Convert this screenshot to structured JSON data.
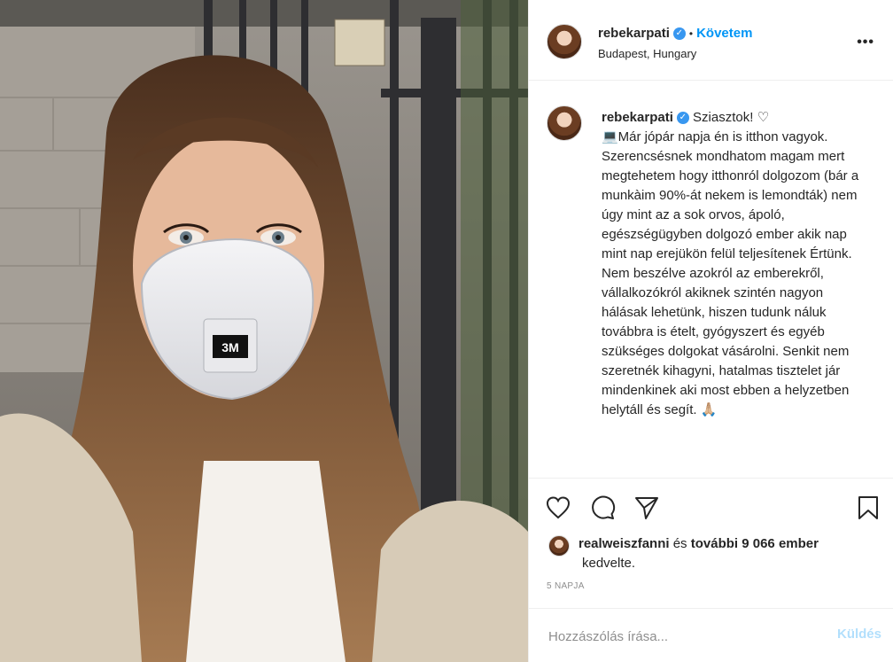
{
  "post": {
    "username": "rebekarpati",
    "verified": true,
    "follow_label": "Követem",
    "location": "Budapest, Hungary",
    "more_label": "•••",
    "caption": "Sziasztok! ♡\n💻Már jópár napja én is itthon vagyok. Szerencsésnek mondhatom magam mert megtehetem hogy itthonról dolgozom (bár a munkàim 90%-át nekem is lemondták) nem úgy mint az a sok orvos, ápoló, egészségügyben dolgozó ember akik nap mint nap erejükön felül teljesítenek Értünk. Nem beszélve azokról az emberekről, vállalkozókról akiknek szintén nagyon hálásak lehetünk, hiszen tudunk náluk továbbra is ételt, gyógyszert és egyéb szükséges dolgokat vásárolni. Senkit nem szeretnék kihagyni, hatalmas tisztelet jár mindenkinek aki most ebben a helyzetben helytáll és segít. 🙏🏼",
    "likes": {
      "liker": "realweiszfanni",
      "connector": " és ",
      "others": "további 9 066 ember",
      "suffix": "kedvelte."
    },
    "timestamp": "5 NAPJA",
    "comment": {
      "placeholder": "Hozzászólás írása...",
      "value": "",
      "post_label": "Küldés"
    }
  },
  "icons": {
    "verified": "verified-badge-icon",
    "like": "heart-icon",
    "comment": "comment-bubble-icon",
    "share": "paper-plane-icon",
    "save": "bookmark-icon"
  },
  "colors": {
    "accent": "#0095f6",
    "verified": "#3897f0",
    "muted": "#8e8e8e",
    "post_button_disabled": "#b2dffc"
  }
}
